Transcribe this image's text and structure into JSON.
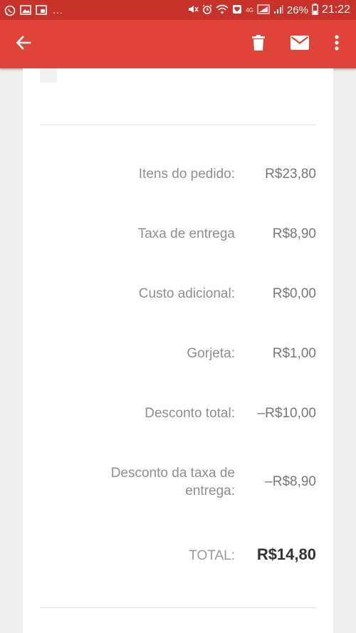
{
  "status_bar": {
    "left_icons": [
      "whatsapp-icon",
      "image-icon",
      "window-icon"
    ],
    "overflow": "...",
    "network": "4G",
    "battery": "26%",
    "time": "21:22"
  },
  "app_bar": {
    "icons": [
      "arrow-left-icon",
      "trash-icon",
      "mail-icon",
      "more-vert-icon"
    ],
    "color": "#de4437"
  },
  "summary": {
    "items": [
      {
        "label": "Itens do pedido:",
        "value": "R$23,80"
      },
      {
        "label": "Taxa de entrega",
        "value": "R$8,90"
      },
      {
        "label": "Custo adicional:",
        "value": "R$0,00"
      },
      {
        "label": "Gorjeta:",
        "value": "R$1,00"
      },
      {
        "label": "Desconto total:",
        "value": "–R$10,00"
      },
      {
        "label_line1": "Desconto da taxa de",
        "label_line2": "entrega:",
        "value": "–R$8,90"
      }
    ],
    "total": {
      "label": "TOTAL:",
      "value": "R$14,80"
    }
  }
}
